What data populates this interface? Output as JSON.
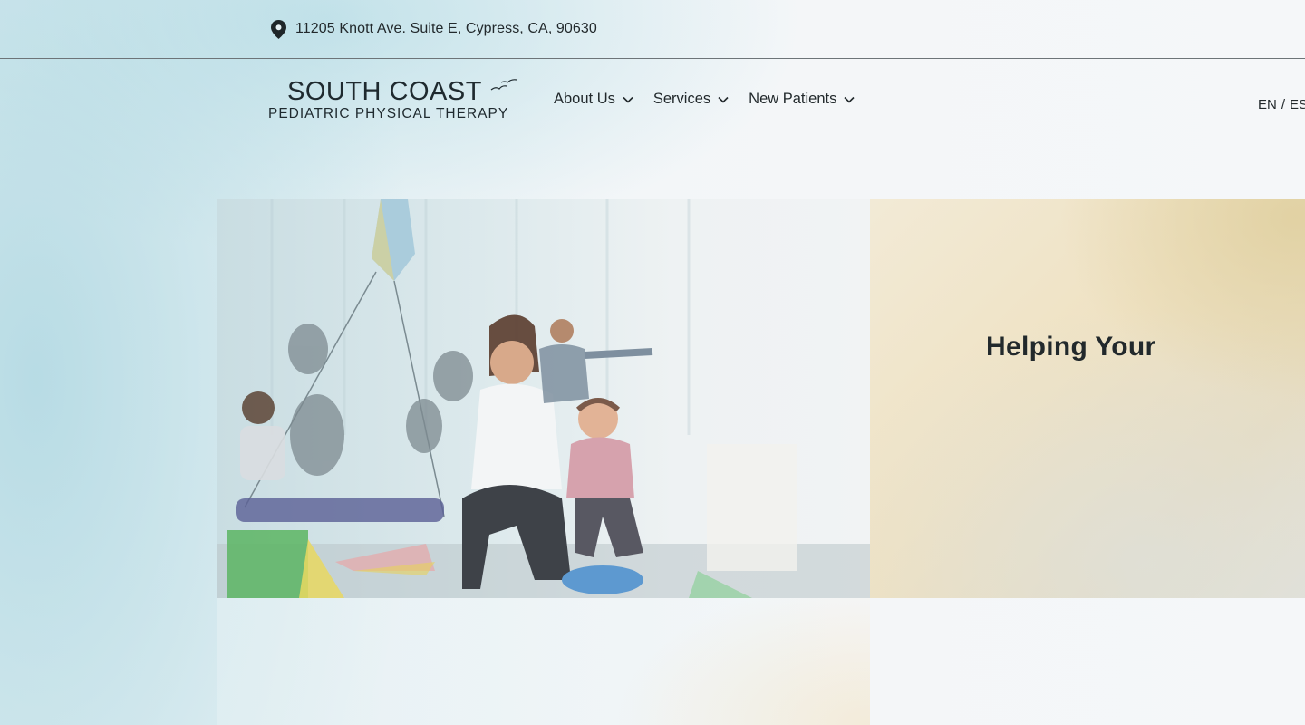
{
  "topbar": {
    "address": "11205 Knott Ave. Suite E, Cypress, CA, 90630",
    "address_icon": "map-pin-icon"
  },
  "brand": {
    "name": "SOUTH COAST",
    "tagline": "PEDIATRIC PHYSICAL THERAPY",
    "logo_icon": "seagulls-icon"
  },
  "nav": {
    "items": [
      {
        "label": "About Us"
      },
      {
        "label": "Services"
      },
      {
        "label": "New Patients"
      }
    ],
    "language": {
      "en": "EN",
      "separator": "/",
      "es": "ES"
    }
  },
  "hero": {
    "heading": "Helping Your",
    "image_icon": "therapist-with-children-photo"
  },
  "colors": {
    "text": "#22292c",
    "panel_accent": "#efe2c3",
    "background": "#f5f7f9",
    "teal_glow": "#b0d8e2"
  }
}
